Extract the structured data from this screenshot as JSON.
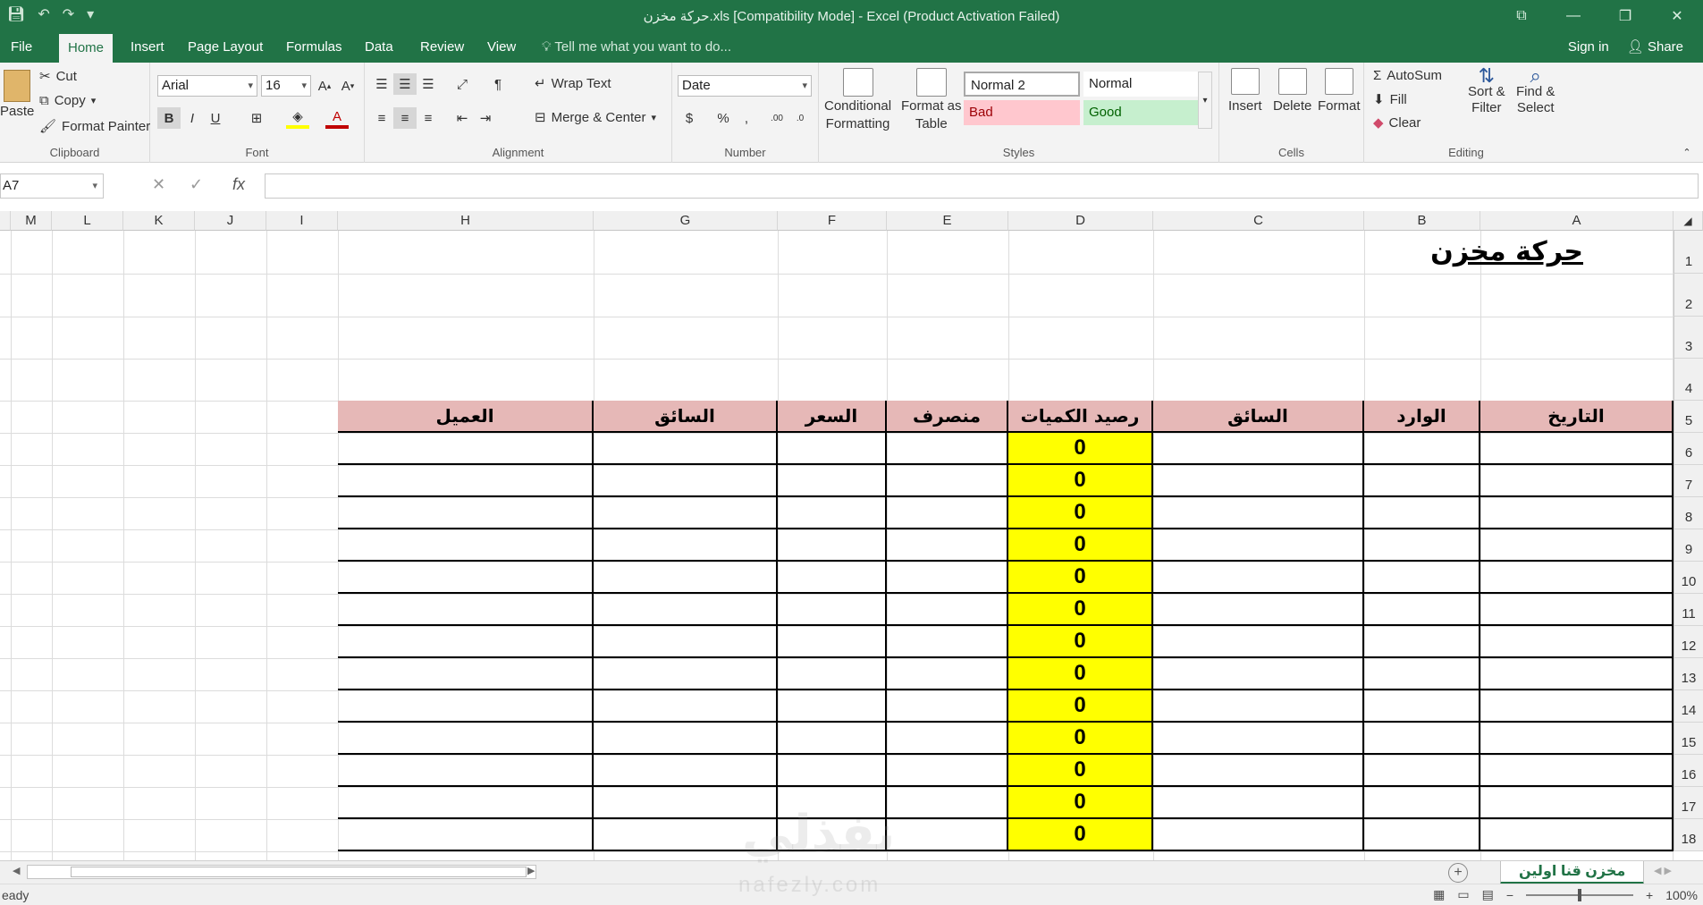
{
  "window": {
    "title": "حركة مخزن.xls  [Compatibility Mode] - Excel (Product Activation Failed)",
    "controls": [
      "⧉",
      "—",
      "❐",
      "✕"
    ]
  },
  "tabs": [
    "File",
    "Home",
    "Insert",
    "Page Layout",
    "Formulas",
    "Data",
    "Review",
    "View"
  ],
  "active_tab": "Home",
  "tell_me": "Tell me what you want to do...",
  "account": {
    "sign_in": "Sign in",
    "share": "Share"
  },
  "ribbon": {
    "clipboard": {
      "paste": "Paste",
      "cut": "Cut",
      "copy": "Copy",
      "format_painter": "Format Painter",
      "label": "Clipboard"
    },
    "font": {
      "name": "Arial",
      "size": "16",
      "bold": "B",
      "italic": "I",
      "underline": "U",
      "label": "Font"
    },
    "alignment": {
      "wrap": "Wrap Text",
      "merge": "Merge & Center",
      "label": "Alignment"
    },
    "number": {
      "format": "Date",
      "label": "Number"
    },
    "styles": {
      "conditional_1": "Conditional",
      "conditional_2": "Formatting",
      "table_1": "Format as",
      "table_2": "Table",
      "normal2": "Normal 2",
      "normal": "Normal",
      "bad": "Bad",
      "good": "Good",
      "label": "Styles"
    },
    "cells": {
      "insert": "Insert",
      "delete": "Delete",
      "format": "Format",
      "label": "Cells"
    },
    "editing": {
      "autosum": "AutoSum",
      "fill": "Fill",
      "clear": "Clear",
      "sort_1": "Sort &",
      "sort_2": "Filter",
      "find_1": "Find &",
      "find_2": "Select",
      "label": "Editing"
    }
  },
  "name_box": "A7",
  "columns": [
    "M",
    "L",
    "K",
    "J",
    "I",
    "H",
    "G",
    "F",
    "E",
    "D",
    "C",
    "B",
    "A"
  ],
  "rows": [
    "1",
    "2",
    "3",
    "4",
    "5",
    "6",
    "7",
    "8",
    "9",
    "10",
    "11",
    "12",
    "13",
    "14",
    "15",
    "16",
    "17",
    "18"
  ],
  "sheet": {
    "title": "حركة مخزن",
    "headers": {
      "A": "التاريخ",
      "B": "الوارد",
      "C": "السائق",
      "D": "رصيد الكميات",
      "E": "منصرف",
      "F": "السعر",
      "G": "السائق",
      "H": "العميل"
    },
    "balance_values": [
      "0",
      "0",
      "0",
      "0",
      "0",
      "0",
      "0",
      "0",
      "0",
      "0",
      "0",
      "0",
      "0"
    ]
  },
  "sheet_tab": "مخزن قنا اولين",
  "status": {
    "left": "eady",
    "zoom": "100%"
  },
  "watermark": {
    "ar": "نفذلي",
    "en": "nafezly.com"
  }
}
